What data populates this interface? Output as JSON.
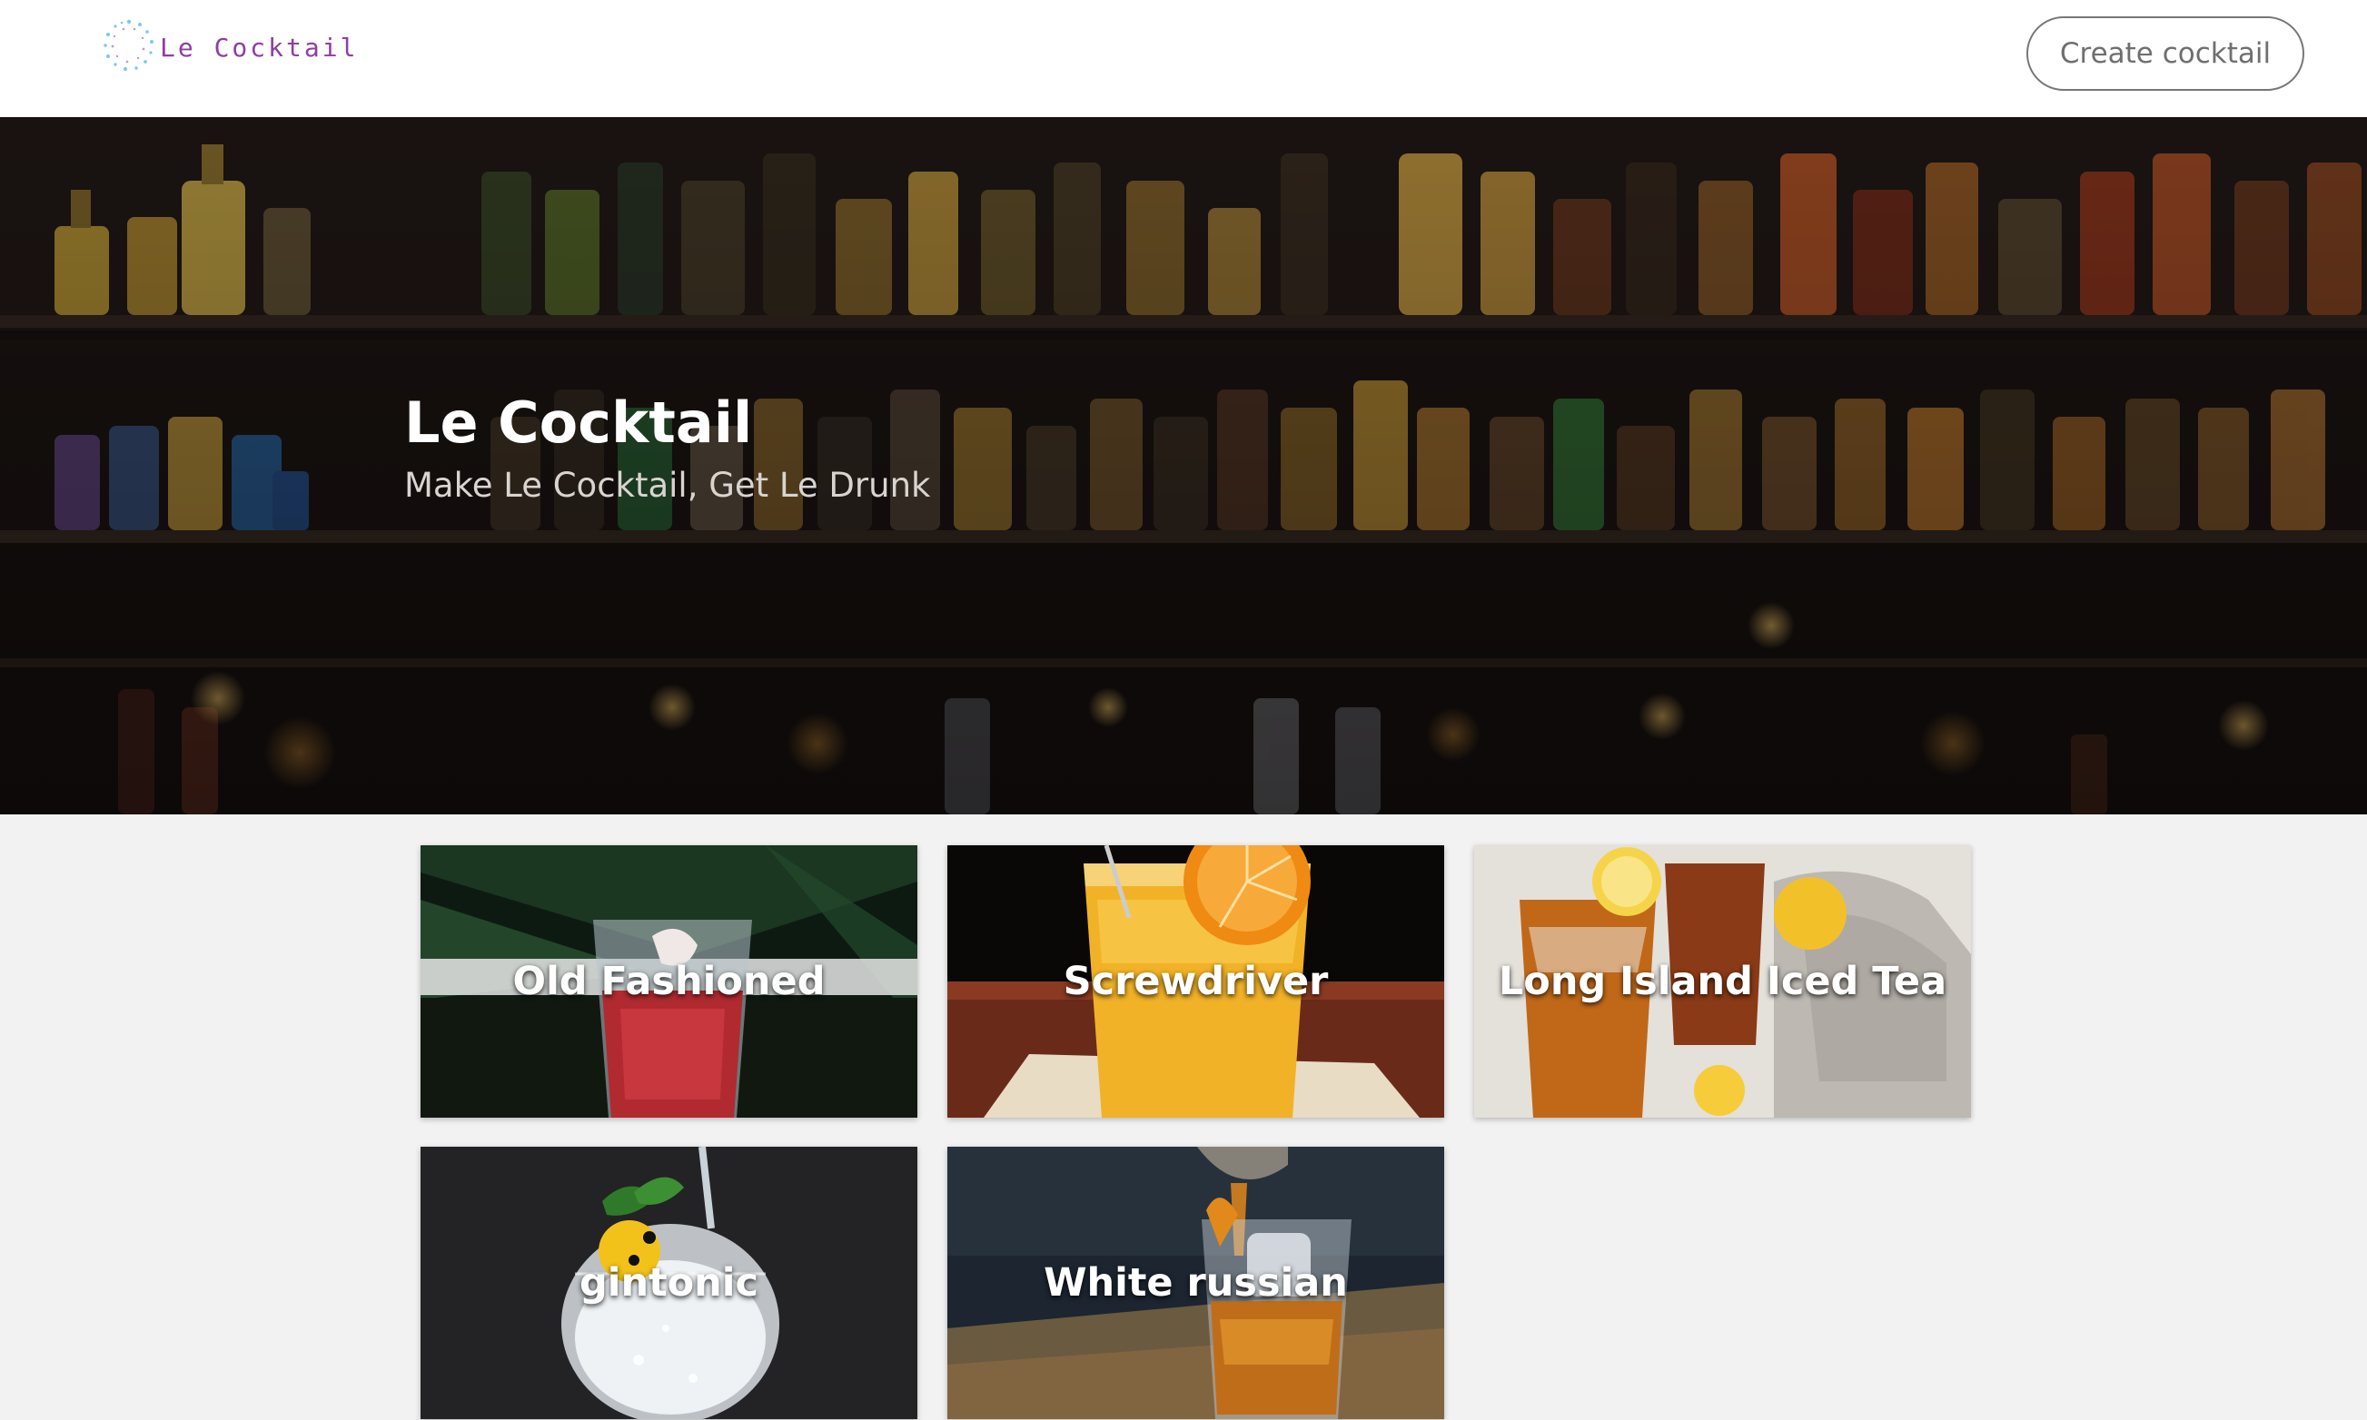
{
  "nav": {
    "brand": "Le Cocktail",
    "create_button": "Create cocktail"
  },
  "hero": {
    "title": "Le Cocktail",
    "subtitle": "Make Le Cocktail, Get Le Drunk"
  },
  "cocktails": [
    {
      "name": "Old Fashioned"
    },
    {
      "name": "Screwdriver"
    },
    {
      "name": "Long Island Iced Tea"
    },
    {
      "name": "gintonic"
    },
    {
      "name": "White russian"
    }
  ],
  "colors": {
    "brand_text": "#8e3fa0",
    "nav_bg": "#ffffff",
    "page_bg": "#f2f2f2"
  }
}
